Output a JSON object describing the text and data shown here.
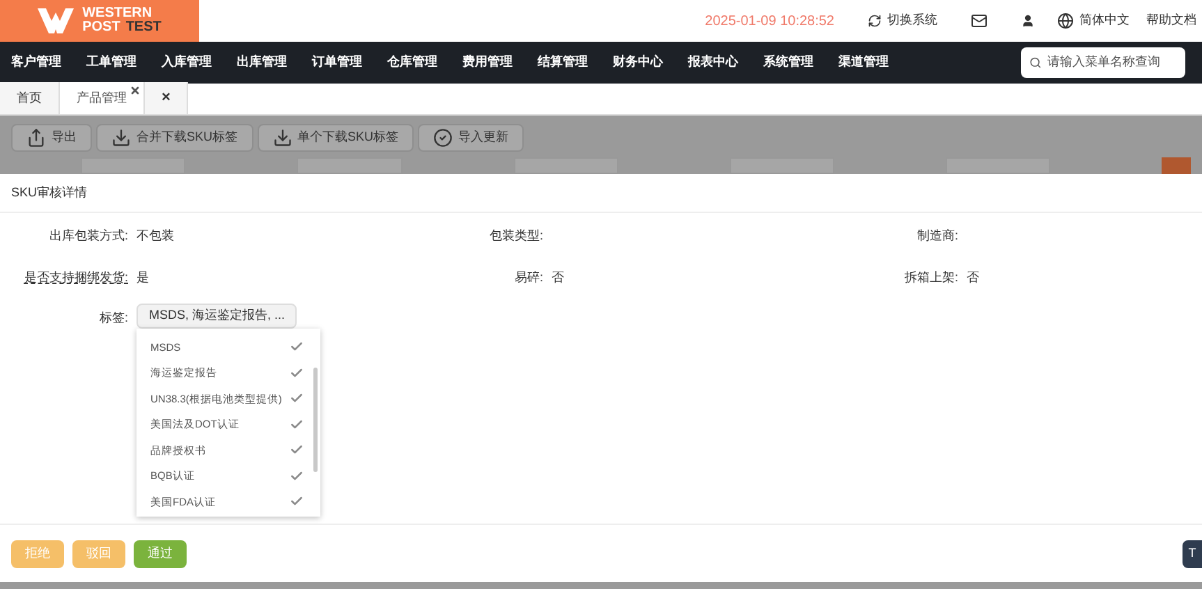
{
  "header": {
    "logo_line1": "WESTERN",
    "logo_line2_a": "POST",
    "logo_line2_b": "TEST",
    "datetime": "2025-01-09 10:28:52",
    "switch_system": "切换系统",
    "language": "简体中文",
    "help": "帮助文档"
  },
  "nav": {
    "items": [
      "客户管理",
      "工单管理",
      "入库管理",
      "出库管理",
      "订单管理",
      "仓库管理",
      "费用管理",
      "结算管理",
      "财务中心",
      "报表中心",
      "系统管理",
      "渠道管理"
    ],
    "search": {
      "placeholder": "请输入菜单名称查询"
    }
  },
  "tabs": [
    {
      "label": "首页",
      "selected": false,
      "closable": false
    },
    {
      "label": "产品管理",
      "selected": true,
      "closable": true
    }
  ],
  "close_all": "×",
  "toolbar": [
    {
      "label": "导出",
      "kind": "export"
    },
    {
      "label": "合并下载SKU标签",
      "kind": "download"
    },
    {
      "label": "单个下载SKU标签",
      "kind": "download"
    },
    {
      "label": "导入更新",
      "kind": "import"
    }
  ],
  "modal": {
    "title": "SKU审核详情",
    "fields": [
      {
        "label": "出库包装方式:",
        "value": "不包装",
        "dashed": false
      },
      {
        "label": "包装类型:",
        "dashed": false
      },
      {
        "label": "制造商:",
        "dashed": false
      },
      {
        "label": "是否支持捆绑发货:",
        "value": "是",
        "dashed": true
      },
      {
        "label": "易碎:",
        "value": "否",
        "dashed": false
      },
      {
        "label": "拆箱上架:",
        "value": "否",
        "dashed": false
      }
    ],
    "tag_label": "标签:",
    "tag_value": "MSDS, 海运鉴定报告, ...",
    "tag_options": [
      {
        "label": "MSDS",
        "checked": true
      },
      {
        "label": "海运鉴定报告",
        "checked": true
      },
      {
        "label": "UN38.3(根据电池类型提供)",
        "checked": true
      },
      {
        "label": "美国法及DOT认证",
        "checked": true
      },
      {
        "label": "品牌授权书",
        "checked": true
      },
      {
        "label": "BQB认证",
        "checked": true
      },
      {
        "label": "美国FDA认证",
        "checked": true
      }
    ],
    "buttons": [
      {
        "label": "拒绝",
        "kind": "warning"
      },
      {
        "label": "驳回",
        "kind": "warning"
      },
      {
        "label": "通过",
        "kind": "success"
      }
    ],
    "corner_button": "T"
  }
}
